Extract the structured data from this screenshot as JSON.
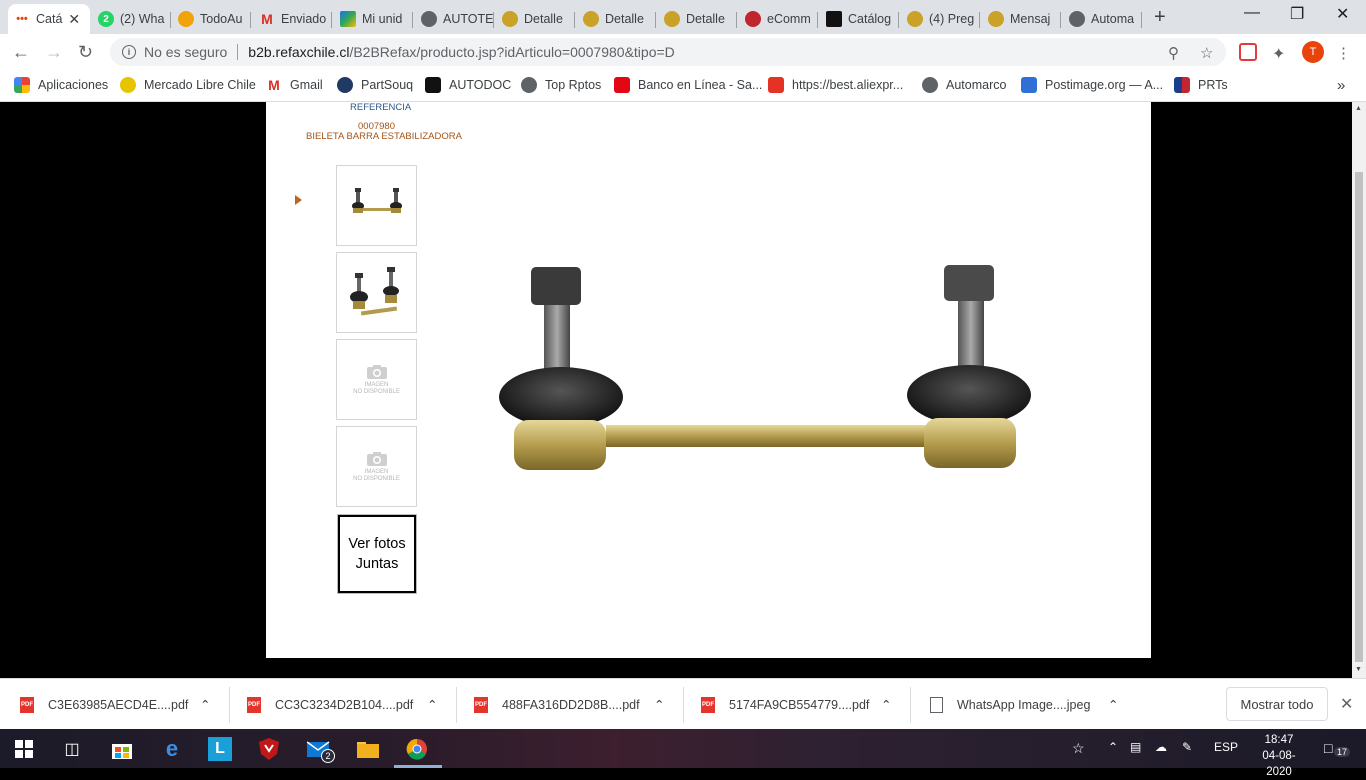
{
  "browser": {
    "tabs": [
      {
        "label": "Catá",
        "color": "#e8430a",
        "active": true
      },
      {
        "label": "(2) Wha",
        "color": "#25d366",
        "badge": "2"
      },
      {
        "label": "TodoAu",
        "color": "#f0a30a"
      },
      {
        "label": "Enviado",
        "color": "#d93025",
        "glyph": "M"
      },
      {
        "label": "Mi unid",
        "color": "#1a73e8"
      },
      {
        "label": "AUTOTE",
        "color": "#5f6368"
      },
      {
        "label": "Detalle",
        "color": "#c9a227"
      },
      {
        "label": "Detalle",
        "color": "#c9a227"
      },
      {
        "label": "Detalle",
        "color": "#c9a227"
      },
      {
        "label": "eComm",
        "color": "#c0262d"
      },
      {
        "label": "Catálog",
        "color": "#111111"
      },
      {
        "label": "(4) Preg",
        "color": "#c9a227"
      },
      {
        "label": "Mensaj",
        "color": "#c9a227"
      },
      {
        "label": "Automa",
        "color": "#5f6368"
      }
    ],
    "new_tab": "+",
    "window": {
      "minimize": "—",
      "restore": "❐",
      "close": "✕"
    },
    "nav": {
      "back": "←",
      "forward": "→",
      "reload": "↻"
    },
    "omnibox": {
      "security_label": "No es seguro",
      "url_host": "b2b.refaxchile.cl",
      "url_path": "/B2BRefax/producto.jsp?idArticulo=0007980&tipo=D"
    },
    "profile_initial": "T",
    "bookmarks": [
      {
        "label": "Aplicaciones",
        "icon": "apps-grid-icon",
        "color": "#ea4335"
      },
      {
        "label": "Mercado Libre Chile",
        "icon": "mercadolibre-icon",
        "color": "#d9b300"
      },
      {
        "label": "Gmail",
        "icon": "gmail-icon",
        "color": "#d93025"
      },
      {
        "label": "PartSouq",
        "icon": "partsouq-icon",
        "color": "#1f3a63"
      },
      {
        "label": "AUTODOC",
        "icon": "autodoc-icon",
        "color": "#111111"
      },
      {
        "label": "Top Rptos",
        "icon": "globe-icon",
        "color": "#5f6368"
      },
      {
        "label": "Banco en Línea - Sa...",
        "icon": "santander-icon",
        "color": "#e30613"
      },
      {
        "label": "https://best.aliexpr...",
        "icon": "aliexpress-icon",
        "color": "#e43225"
      },
      {
        "label": "Automarco",
        "icon": "globe-icon",
        "color": "#5f6368"
      },
      {
        "label": "Postimage.org — A...",
        "icon": "postimage-icon",
        "color": "#2f6fd6"
      },
      {
        "label": "PRTs",
        "icon": "prts-icon",
        "color": "#c4262e"
      }
    ],
    "bookmarks_overflow": "»"
  },
  "product": {
    "reference_label": "REFERENCIA",
    "code": "0007980",
    "description": "BIELETA BARRA ESTABILIZADORA",
    "no_image_line1": "IMAGEN",
    "no_image_line2": "NO DISPONIBLE",
    "view_all_button": "Ver fotos Juntas",
    "selected_thumbnail": 1
  },
  "downloads": {
    "items": [
      {
        "name": "C3E63985AECD4E....pdf",
        "type": "pdf"
      },
      {
        "name": "CC3C3234D2B104....pdf",
        "type": "pdf"
      },
      {
        "name": "488FA316DD2D8B....pdf",
        "type": "pdf"
      },
      {
        "name": "5174FA9CB554779....pdf",
        "type": "pdf"
      },
      {
        "name": "WhatsApp Image....jpeg",
        "type": "image"
      }
    ],
    "show_all": "Mostrar todo",
    "pdf_badge": "PDF"
  },
  "taskbar": {
    "mail_badge": "2",
    "language": "ESP",
    "time": "18:47",
    "date": "04-08-2020",
    "notifications": "17"
  },
  "colors": {
    "accent_orange": "#a45418",
    "reference_blue": "#2b5a8a",
    "page_background": "#000000"
  }
}
